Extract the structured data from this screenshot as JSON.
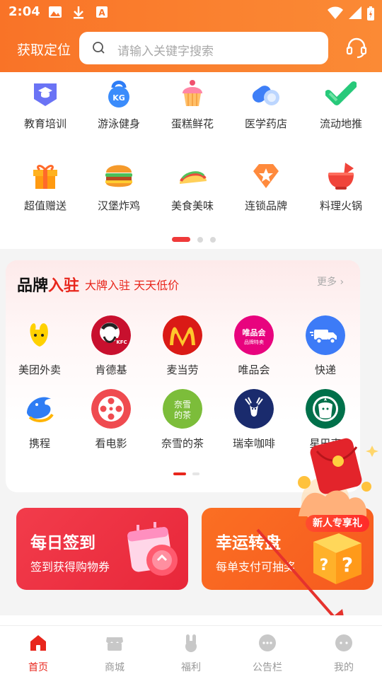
{
  "status_bar": {
    "time": "2:04"
  },
  "header": {
    "location_label": "获取定位",
    "search_placeholder": "请输入关键字搜索"
  },
  "categories": [
    {
      "label": "教育培训",
      "icon": "graduation-cap-icon"
    },
    {
      "label": "游泳健身",
      "icon": "kettlebell-icon"
    },
    {
      "label": "蛋糕鲜花",
      "icon": "cupcake-icon"
    },
    {
      "label": "医学药店",
      "icon": "pill-icon"
    },
    {
      "label": "流动地推",
      "icon": "check-badge-icon"
    },
    {
      "label": "超值赠送",
      "icon": "gift-icon"
    },
    {
      "label": "汉堡炸鸡",
      "icon": "burger-icon"
    },
    {
      "label": "美食美味",
      "icon": "taco-icon"
    },
    {
      "label": "连锁品牌",
      "icon": "star-diamond-icon"
    },
    {
      "label": "料理火锅",
      "icon": "mortar-icon"
    }
  ],
  "brands": {
    "title_black": "品牌",
    "title_red": "入驻",
    "subtitle1": "大牌入驻",
    "subtitle2": "天天低价",
    "more_label": "更多",
    "items": [
      {
        "label": "美团外卖",
        "icon": "meituan-logo"
      },
      {
        "label": "肯德基",
        "icon": "kfc-logo"
      },
      {
        "label": "麦当劳",
        "icon": "mcdonalds-logo"
      },
      {
        "label": "唯品会",
        "icon": "vip-logo"
      },
      {
        "label": "快递",
        "icon": "delivery-truck-icon"
      },
      {
        "label": "携程",
        "icon": "ctrip-dolphin-logo"
      },
      {
        "label": "看电影",
        "icon": "film-reel-icon"
      },
      {
        "label": "奈雪的茶",
        "icon": "nayuki-logo"
      },
      {
        "label": "瑞幸咖啡",
        "icon": "luckin-deer-logo"
      },
      {
        "label": "星巴克",
        "icon": "starbucks-logo"
      }
    ]
  },
  "cards": [
    {
      "title": "每日签到",
      "subtitle": "签到获得购物券",
      "color": "#ee3243"
    },
    {
      "title": "幸运转盘",
      "subtitle": "每单支付可抽奖",
      "color": "#f86721"
    }
  ],
  "promo": {
    "badge": "新人专享礼"
  },
  "tabs": [
    {
      "label": "首页",
      "icon": "home-icon",
      "active": true
    },
    {
      "label": "商城",
      "icon": "store-icon",
      "active": false
    },
    {
      "label": "福利",
      "icon": "bunny-icon",
      "active": false
    },
    {
      "label": "公告栏",
      "icon": "chat-bubble-icon",
      "active": false
    },
    {
      "label": "我的",
      "icon": "profile-chat-icon",
      "active": false
    }
  ],
  "colors": {
    "brand_orange": "#f97327",
    "accent_red": "#e8261c"
  }
}
